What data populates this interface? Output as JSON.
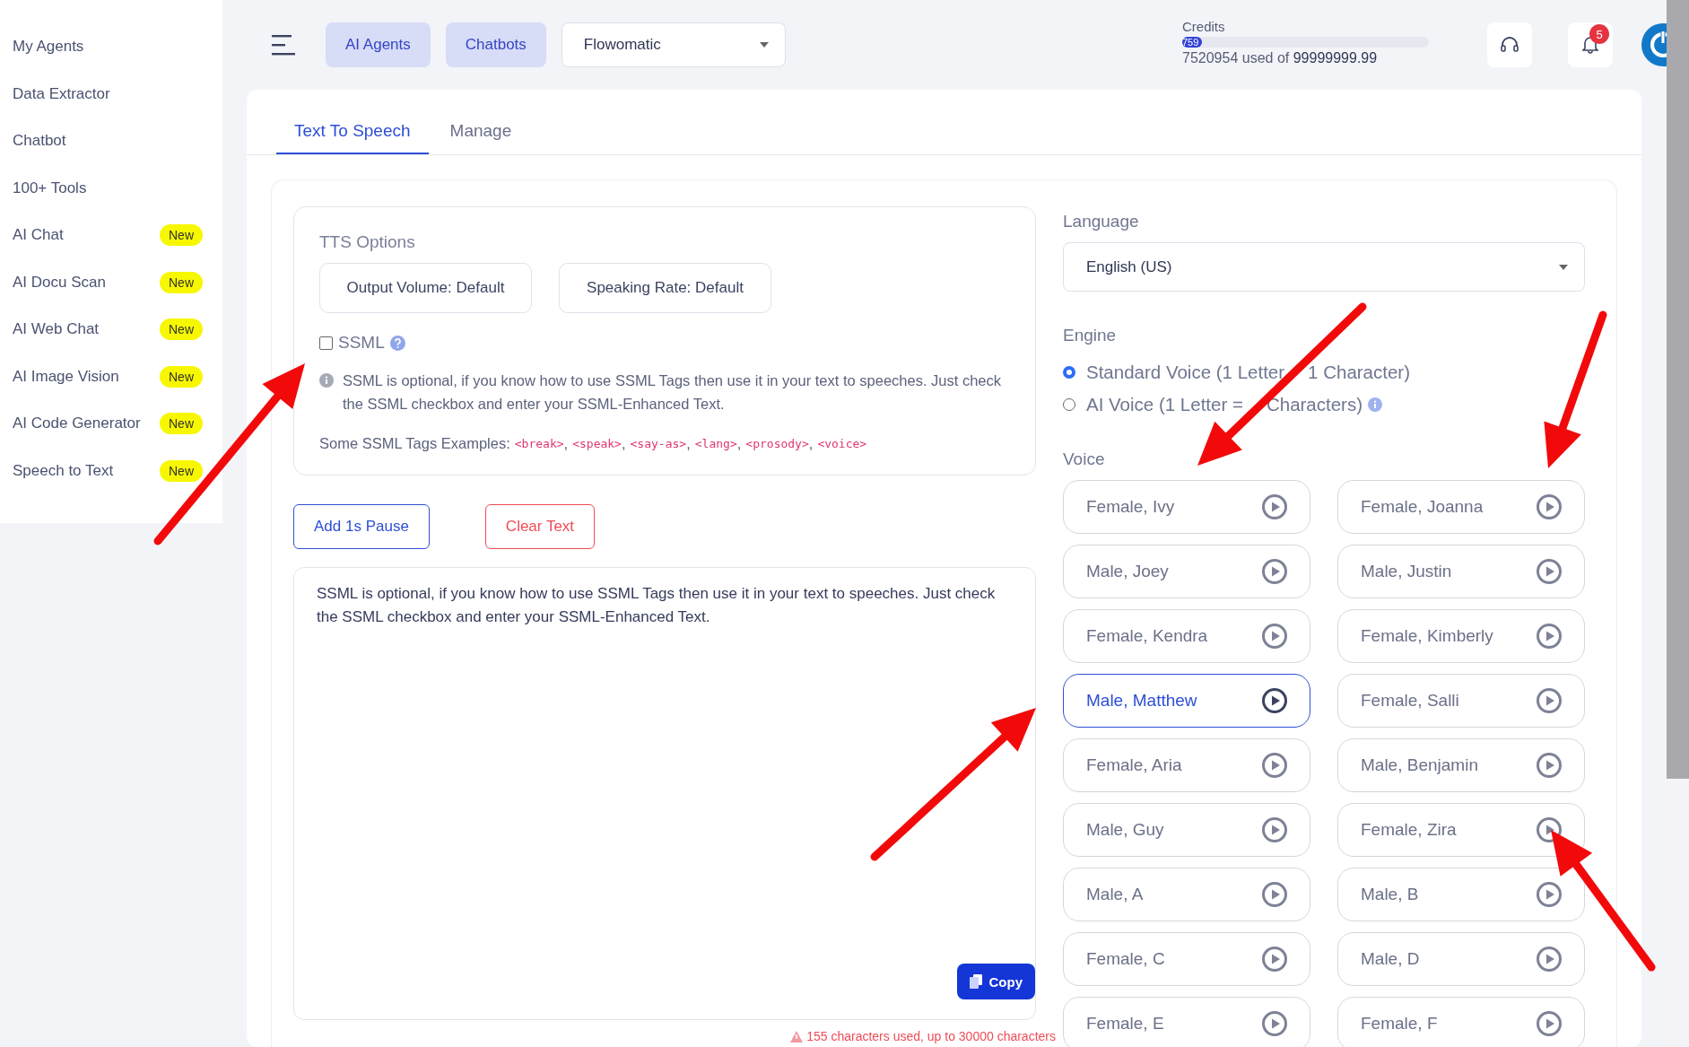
{
  "sidebar": {
    "items": [
      {
        "label": "My Agents"
      },
      {
        "label": "Data Extractor"
      },
      {
        "label": "Chatbot"
      },
      {
        "label": "100+ Tools"
      },
      {
        "label": "AI Chat",
        "badge": "New"
      },
      {
        "label": "AI Docu Scan",
        "badge": "New"
      },
      {
        "label": "AI Web Chat",
        "badge": "New"
      },
      {
        "label": "AI Image Vision",
        "badge": "New"
      },
      {
        "label": "AI Code Generator",
        "badge": "New"
      },
      {
        "label": "Speech to Text",
        "badge": "New"
      }
    ]
  },
  "topbar": {
    "nav_buttons": [
      "AI Agents",
      "Chatbots"
    ],
    "workspace": "Flowomatic",
    "credits": {
      "label": "Credits",
      "percent": "759",
      "level": 0.08,
      "used": "7520954",
      "used_of": "used of",
      "total": "99999999.99"
    },
    "notifications": "5"
  },
  "tabs": [
    {
      "label": "Text To Speech",
      "selected": true
    },
    {
      "label": "Manage",
      "selected": false
    }
  ],
  "tts_options": {
    "title": "TTS Options",
    "buttons": [
      "Output Volume: Default",
      "Speaking Rate: Default"
    ],
    "ssml": {
      "label": "SSML",
      "checked": false
    },
    "info": "SSML is optional, if you know how to use SSML Tags then use it in your text to speeches. Just check the SSML checkbox and enter your SSML-Enhanced Text.",
    "examples_label": "Some SSML Tags Examples:",
    "tag_separator": ",",
    "examples": [
      "<break>",
      "<speak>",
      "<say-as>",
      "<lang>",
      "<prosody>",
      "<voice>"
    ]
  },
  "actions": {
    "pause": "Add 1s Pause",
    "clear": "Clear Text"
  },
  "editor": {
    "value": "SSML is optional, if you know how to use SSML Tags then use it in your text to speeches. Just check the SSML checkbox and enter your SSML-Enhanced Text.",
    "copy": "Copy",
    "counter": "155 characters used, up to 30000 characters"
  },
  "language": {
    "label": "Language",
    "value": "English (US)"
  },
  "engine": {
    "label": "Engine",
    "options": [
      {
        "label_parts": [
          "Standard Voice (1 Letter",
          "1 Character)"
        ],
        "selected": true
      },
      {
        "label_parts": [
          "AI Voice (1 Letter =",
          "Characters)"
        ],
        "selected": false,
        "info": true
      }
    ]
  },
  "voice": {
    "label": "Voice",
    "options": [
      {
        "label": "Female, Ivy",
        "selected": false
      },
      {
        "label": "Female, Joanna",
        "selected": false
      },
      {
        "label": "Male, Joey",
        "selected": false
      },
      {
        "label": "Male, Justin",
        "selected": false
      },
      {
        "label": "Female, Kendra",
        "selected": false
      },
      {
        "label": "Female, Kimberly",
        "selected": false
      },
      {
        "label": "Male, Matthew",
        "selected": true
      },
      {
        "label": "Female, Salli",
        "selected": false
      },
      {
        "label": "Female, Aria",
        "selected": false
      },
      {
        "label": "Male, Benjamin",
        "selected": false
      },
      {
        "label": "Male, Guy",
        "selected": false
      },
      {
        "label": "Female, Zira",
        "selected": false
      },
      {
        "label": "Male, A",
        "selected": false
      },
      {
        "label": "Male, B",
        "selected": false
      },
      {
        "label": "Female, C",
        "selected": false
      },
      {
        "label": "Male, D",
        "selected": false
      },
      {
        "label": "Female, E",
        "selected": false
      },
      {
        "label": "Female, F",
        "selected": false
      }
    ]
  }
}
